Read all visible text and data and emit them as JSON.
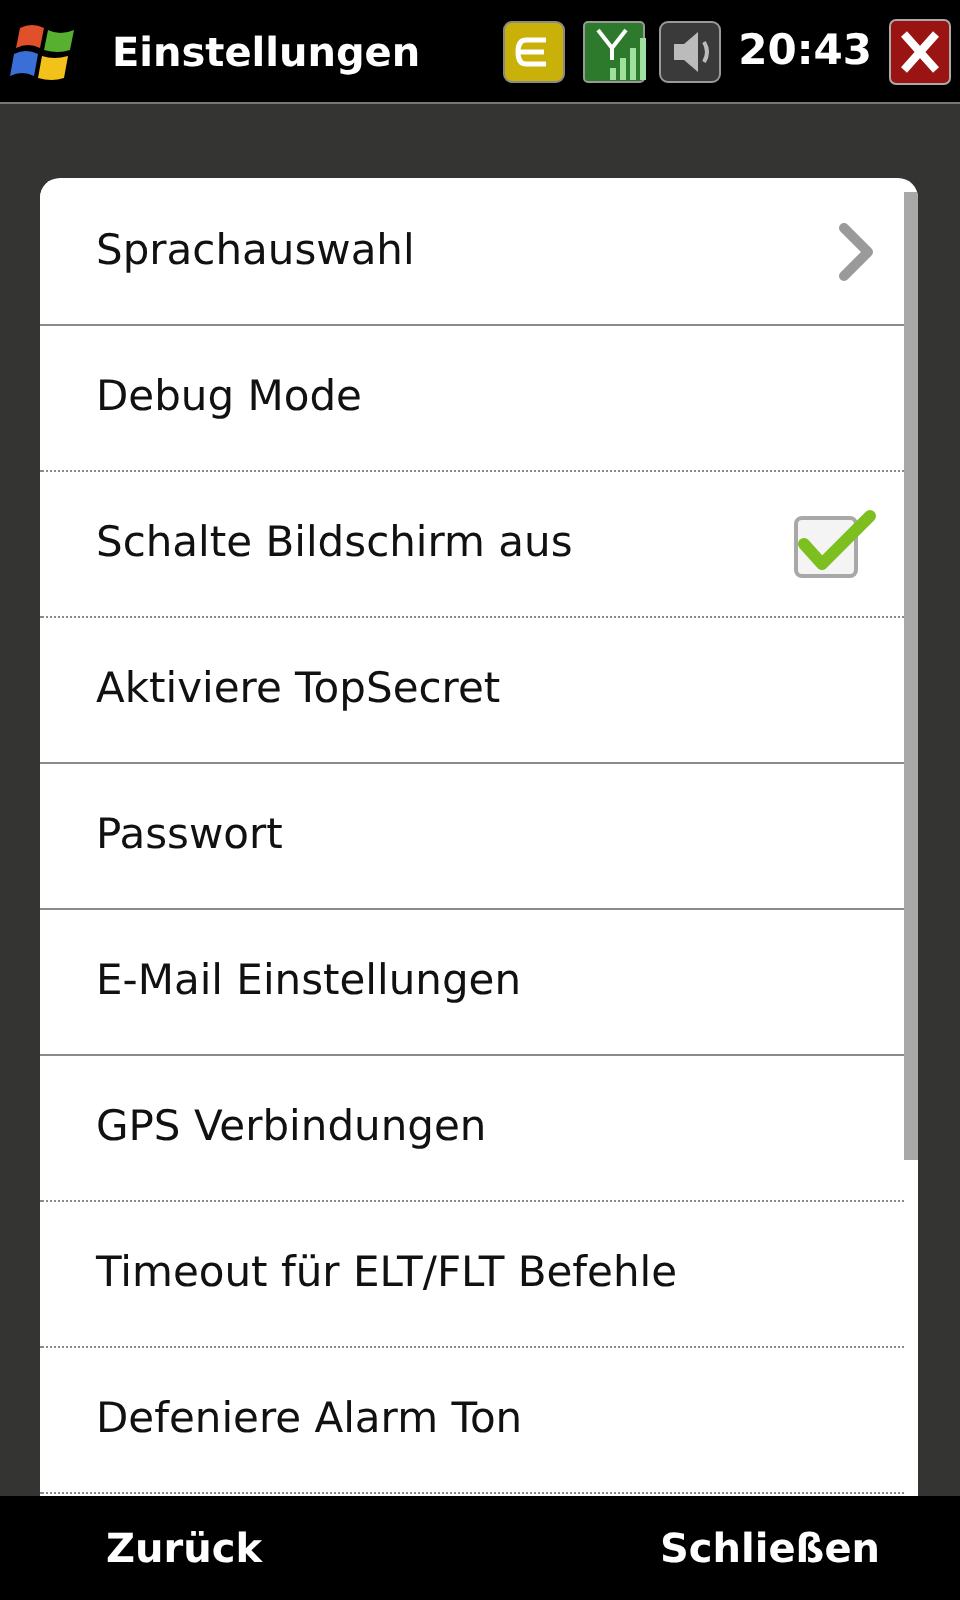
{
  "title_bar": {
    "title": "Einstellungen",
    "time": "20:43"
  },
  "items": [
    {
      "label": "Sprachauswahl",
      "kind": "submenu",
      "dotted_divider": false
    },
    {
      "label": "Debug Mode",
      "kind": "plain",
      "dotted_divider": true
    },
    {
      "label": "Schalte Bildschirm aus",
      "kind": "checkbox",
      "checked": true,
      "dotted_divider": true
    },
    {
      "label": "Aktiviere TopSecret",
      "kind": "plain",
      "dotted_divider": false
    },
    {
      "label": "Passwort",
      "kind": "plain",
      "dotted_divider": false
    },
    {
      "label": "E-Mail Einstellungen",
      "kind": "plain",
      "dotted_divider": false
    },
    {
      "label": "GPS Verbindungen",
      "kind": "plain",
      "dotted_divider": true
    },
    {
      "label": "Timeout für ELT/FLT Befehle",
      "kind": "plain",
      "dotted_divider": true
    },
    {
      "label": "Defeniere Alarm Ton",
      "kind": "plain",
      "dotted_divider": true
    }
  ],
  "soft_keys": {
    "left": "Zurück",
    "right": "Schließen"
  }
}
